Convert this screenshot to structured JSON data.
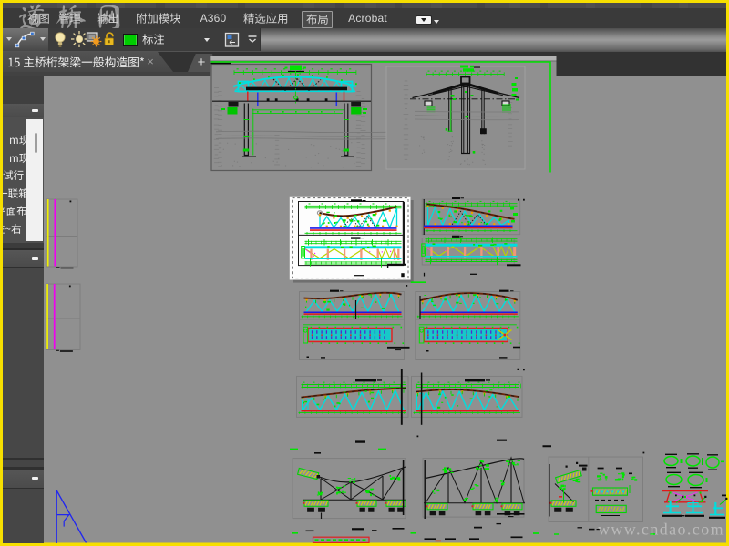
{
  "window": {
    "frame_color": "#f6df00",
    "theme": "autocad-dark"
  },
  "ribbon": {
    "tabs": [
      {
        "label": "视图",
        "active": false
      },
      {
        "label": "管理",
        "active": false
      },
      {
        "label": "输出",
        "active": false
      },
      {
        "label": "附加模块",
        "active": false
      },
      {
        "label": "A360",
        "active": false
      },
      {
        "label": "精选应用",
        "active": false
      },
      {
        "label": "布局",
        "active": true
      },
      {
        "label": "Acrobat",
        "active": false
      }
    ],
    "toolbar": {
      "layer_combo_value": "标注",
      "swatch_color": "#00cc00",
      "icons": [
        "spline-icon",
        "light-bulb-icon",
        "sun-icon",
        "layer-freeze-icon",
        "unlock-icon",
        "color-swatch",
        "layer-states-icon",
        "ribbon-collapse-icon"
      ]
    }
  },
  "file_tabs": {
    "active_tab": "15 主桥桁架梁一般构造图*",
    "close_glyph": "×",
    "new_tab_glyph": "+"
  },
  "sidebar": {
    "collapse_glyph": "–",
    "sections": 3,
    "items": [
      "m现",
      "m现",
      "试行",
      "一联箱",
      "平面布",
      "左~右"
    ]
  },
  "canvas": {
    "background": "#919191",
    "watermark": "www.cndao.com",
    "paper_selected": true,
    "cad_colors": {
      "green": "#00d400",
      "cyan": "#00dede",
      "yellow": "#f0f000",
      "magenta": "#f000f0",
      "red": "#e01818",
      "blue": "#1a1ae8",
      "brown": "#6b2408",
      "salmon": "#f09878"
    }
  },
  "watermark_overlay": "道桥网"
}
